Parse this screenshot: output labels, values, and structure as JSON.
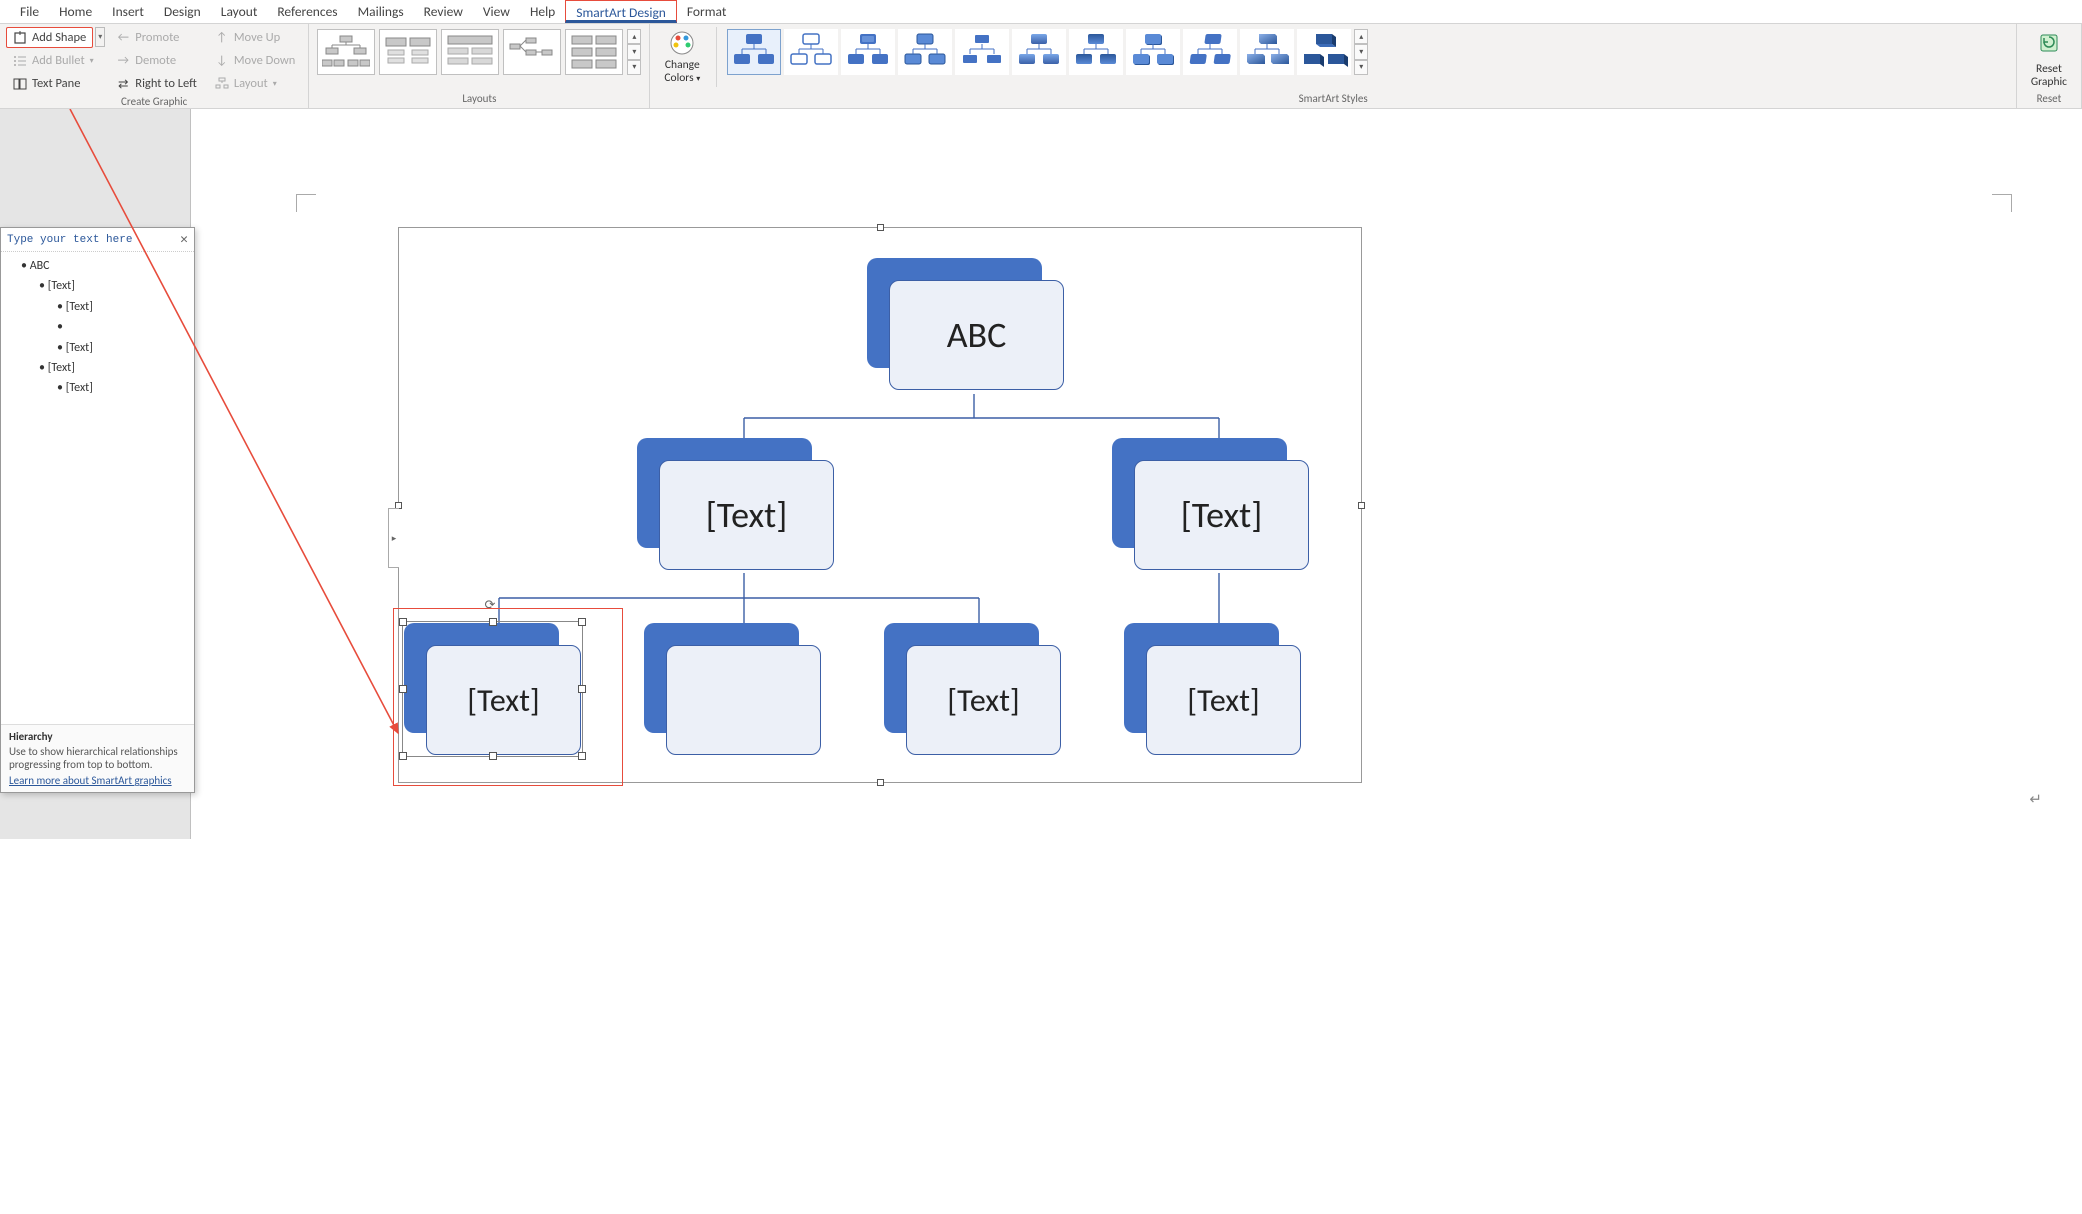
{
  "tabs": {
    "file": "File",
    "home": "Home",
    "insert": "Insert",
    "design": "Design",
    "layout": "Layout",
    "references": "References",
    "mailings": "Mailings",
    "review": "Review",
    "view": "View",
    "help": "Help",
    "smartart_design": "SmartArt Design",
    "format": "Format"
  },
  "create_graphic": {
    "add_shape": "Add Shape",
    "add_bullet": "Add Bullet",
    "text_pane": "Text Pane",
    "promote": "Promote",
    "demote": "Demote",
    "right_to_left": "Right to Left",
    "move_up": "Move Up",
    "move_down": "Move Down",
    "layout": "Layout",
    "group_label": "Create Graphic"
  },
  "layouts": {
    "group_label": "Layouts"
  },
  "change_colors": {
    "label_line1": "Change",
    "label_line2": "Colors"
  },
  "styles": {
    "group_label": "SmartArt Styles"
  },
  "reset": {
    "label_line1": "Reset",
    "label_line2": "Graphic",
    "group_label": "Reset"
  },
  "text_pane_panel": {
    "header": "Type your text here",
    "items": [
      {
        "level": 1,
        "text": "ABC"
      },
      {
        "level": 2,
        "text": "[Text]"
      },
      {
        "level": 3,
        "text": "[Text]"
      },
      {
        "level": 3,
        "text": ""
      },
      {
        "level": 3,
        "text": "[Text]"
      },
      {
        "level": 2,
        "text": "[Text]"
      },
      {
        "level": 3,
        "text": "[Text]"
      }
    ],
    "footer_title": "Hierarchy",
    "footer_desc": "Use to show hierarchical relationships progressing from top to bottom.",
    "footer_link": "Learn more about SmartArt graphics"
  },
  "smartart_nodes": {
    "root": "ABC",
    "l2a": "[Text]",
    "l2b": "[Text]",
    "l3a": "[Text]",
    "l3b": "",
    "l3c": "[Text]",
    "l3d": "[Text]"
  }
}
